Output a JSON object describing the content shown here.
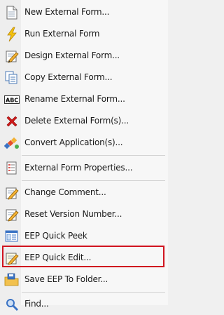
{
  "menu": {
    "items": [
      {
        "label": "New External Form...",
        "icon": "new-form-icon"
      },
      {
        "label": "Run External Form",
        "icon": "lightning-icon"
      },
      {
        "label": "Design External Form...",
        "icon": "design-pencil-icon"
      },
      {
        "label": "Copy External Form...",
        "icon": "copy-icon"
      },
      {
        "label": "Rename External Form...",
        "icon": "rename-abc-icon"
      },
      {
        "label": "Delete External Form(s)...",
        "icon": "delete-x-icon"
      },
      {
        "label": "Convert Application(s)...",
        "icon": "convert-icon"
      },
      {
        "label": "External Form Properties...",
        "icon": "properties-icon"
      },
      {
        "label": "Change Comment...",
        "icon": "change-comment-icon"
      },
      {
        "label": "Reset Version Number...",
        "icon": "reset-version-icon"
      },
      {
        "label": "EEP Quick Peek",
        "icon": "quick-peek-icon"
      },
      {
        "label": "EEP Quick Edit...",
        "icon": "quick-edit-icon",
        "highlighted": true
      },
      {
        "label": "Save EEP To Folder...",
        "icon": "save-folder-icon"
      },
      {
        "label": "Find...",
        "icon": "find-icon"
      }
    ]
  },
  "colors": {
    "highlight_border": "#d0141f",
    "delete_red": "#d01a1a",
    "lightning_yellow": "#f4c20d"
  }
}
